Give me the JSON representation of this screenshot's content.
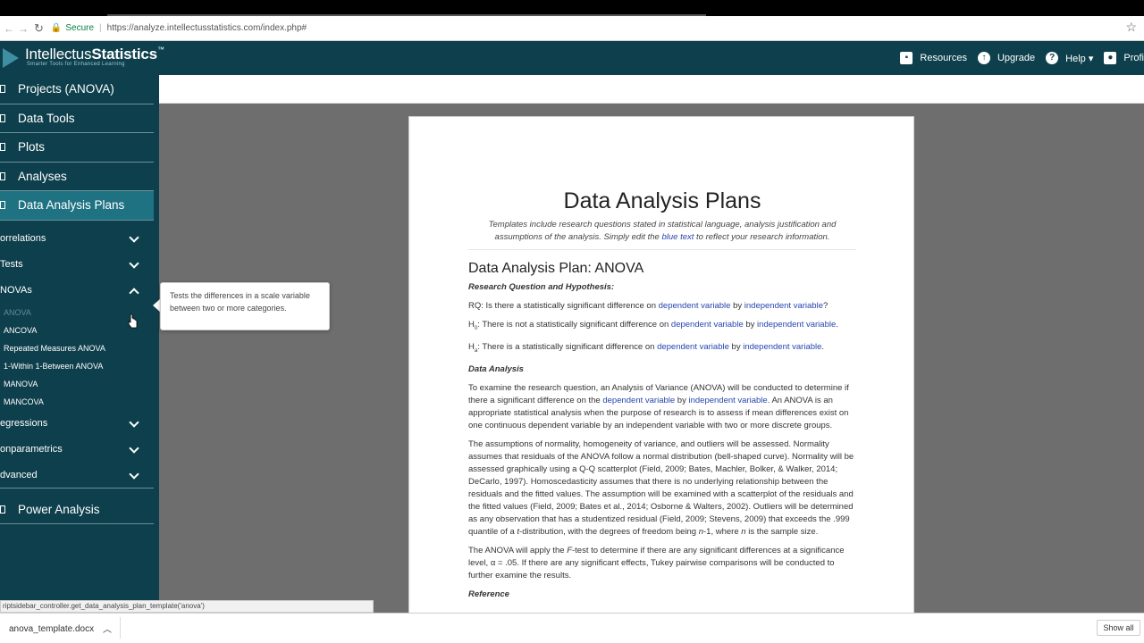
{
  "browser": {
    "back_arrow": "←",
    "forward_arrow": "→",
    "reload_icon": "↻",
    "lock_icon": "🔒",
    "secure_label": "Secure",
    "separator": "|",
    "url": "https://analyze.intellectusstatistics.com/index.php#",
    "star_icon": "☆"
  },
  "app": {
    "logo_light": "Intellectus",
    "logo_bold": "Statistics",
    "logo_tm": "™",
    "tagline": "Smarter Tools for Enhanced Learning"
  },
  "topnav": {
    "resources": "Resources",
    "upgrade": "Upgrade",
    "upgrade_icon": "↑",
    "help": "Help ▾",
    "help_icon": "?",
    "profile": "Profi"
  },
  "sidebar": {
    "projects": "Projects (ANOVA)",
    "data_tools": "Data Tools",
    "plots": "Plots",
    "analyses": "Analyses",
    "data_analysis_plans": "Data Analysis Plans",
    "correlations": "orrelations",
    "tests": "Tests",
    "anovas": "NOVAs",
    "anova": "ANOVA",
    "ancova": "ANCOVA",
    "repeated": "Repeated Measures ANOVA",
    "within_between": "1-Within 1-Between ANOVA",
    "manova": "MANOVA",
    "mancova": "MANCOVA",
    "regressions": "egressions",
    "nonparametrics": "onparametrics",
    "advanced": "dvanced",
    "power": "Power Analysis"
  },
  "tooltip": "Tests the differences in a scale variable between two or more categories.",
  "doc": {
    "title": "Data Analysis Plans",
    "sub_a": "Templates include research questions stated in statistical language, analysis justification and assumptions of the analysis.  Simply edit the ",
    "sub_blue": "blue text",
    "sub_b": " to reflect your research information.",
    "plan_title": "Data Analysis Plan: ANOVA",
    "rq_heading": "Research Question and Hypothesis:",
    "rq_a": "RQ: Is there a statistically significant difference on ",
    "dv": "dependent variable",
    "by": " by ",
    "iv": "independent variable",
    "rq_end": "?",
    "h": "H",
    "h0_sub": "0",
    "h0_a": ": There is not a statistically significant difference on ",
    "ha_sub": "a",
    "ha_a": ": There is a statistically significant difference on ",
    "period": ".",
    "da_heading": "Data Analysis",
    "p1_a": "To examine the research question, an Analysis of Variance (ANOVA) will be conducted to determine if there a significant difference on the ",
    "p1_b": ". An ANOVA is an appropriate statistical analysis when the purpose of research is to assess if mean differences exist on one continuous dependent variable by an independent variable with two or more discrete groups.",
    "p2_a": "The assumptions of normality, homogeneity of variance, and outliers will be assessed. Normality assumes that residuals of the ANOVA follow a normal distribution (bell-shaped curve). Normality will be assessed graphically using a Q-Q scatterplot (Field, 2009; Bates, Machler, Bolker, & Walker, 2014; DeCarlo, 1997). Homoscedasticity assumes that there is no underlying relationship between the residuals and the fitted values. The assumption will be examined with a scatterplot of the residuals and the fitted values (Field, 2009; Bates et al., 2014; Osborne & Walters, 2002). Outliers will be determined as any observation that has a studentized residual (Field, 2009; Stevens, 2009) that exceeds the .999 quantile of a ",
    "p2_t": "t",
    "p2_b": "-distribution, with the degrees of freedom being ",
    "p2_n1": "n",
    "p2_c": "-1, where ",
    "p2_n2": "n",
    "p2_d": " is the sample size.",
    "p3_a": "The ANOVA will apply the ",
    "p3_f": "F",
    "p3_b": "-test to determine if there are any significant differences at a significance level, α = .05. If there are any significant effects, Tukey pairwise comparisons will be conducted to further examine the results.",
    "ref_heading": "Reference"
  },
  "status_text": "riptsidebar_controller.get_data_analysis_plan_template('anova')",
  "downloads": {
    "file": "anova_template.docx",
    "caret": "︿",
    "show_all": "Show all"
  }
}
